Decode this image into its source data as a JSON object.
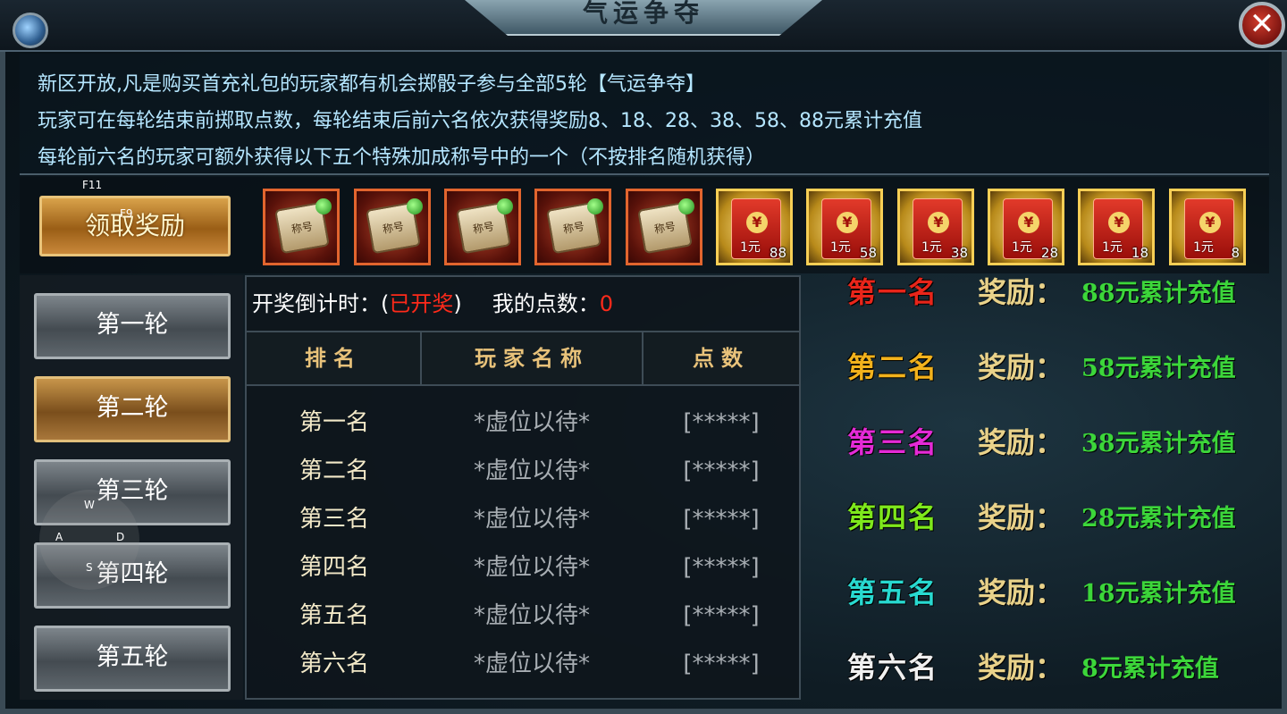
{
  "window": {
    "title": "气运争夺",
    "close_glyph": "✕"
  },
  "intro": {
    "lines": [
      "新区开放,凡是购买首充礼包的玩家都有机会掷骰子参与全部5轮【气运争夺】",
      "玩家可在每轮结束前掷取点数，每轮结束后前六名依次获得奖励8、18、28、38、58、88元累计充值",
      "每轮前六名的玩家可额外获得以下五个特殊加成称号中的一个（不按排名随机获得）"
    ]
  },
  "hotkeys": {
    "f11": "F11",
    "f9": "F9",
    "w": "W",
    "a": "A",
    "s": "S",
    "d": "D"
  },
  "claim_button": {
    "label": "领取奖励"
  },
  "title_items": [
    {
      "label": "称号"
    },
    {
      "label": "称号"
    },
    {
      "label": "称号"
    },
    {
      "label": "称号"
    },
    {
      "label": "称号"
    }
  ],
  "red_envelopes": [
    {
      "label": "1元",
      "qty": "88"
    },
    {
      "label": "1元",
      "qty": "58"
    },
    {
      "label": "1元",
      "qty": "38"
    },
    {
      "label": "1元",
      "qty": "28"
    },
    {
      "label": "1元",
      "qty": "18"
    },
    {
      "label": "1元",
      "qty": "8"
    }
  ],
  "rounds": [
    {
      "label": "第一轮",
      "active": false
    },
    {
      "label": "第二轮",
      "active": true
    },
    {
      "label": "第三轮",
      "active": false
    },
    {
      "label": "第四轮",
      "active": false
    },
    {
      "label": "第五轮",
      "active": false
    }
  ],
  "status": {
    "countdown_label": "开奖倒计时：(",
    "countdown_value": "已开奖",
    "countdown_close": ")",
    "points_label": "我的点数：",
    "points_value": "0"
  },
  "table": {
    "headers": [
      "排名",
      "玩家名称",
      "点数"
    ],
    "rows": [
      {
        "rank": "第一名",
        "name": "*虚位以待*",
        "points": "[*****]"
      },
      {
        "rank": "第二名",
        "name": "*虚位以待*",
        "points": "[*****]"
      },
      {
        "rank": "第三名",
        "name": "*虚位以待*",
        "points": "[*****]"
      },
      {
        "rank": "第四名",
        "name": "*虚位以待*",
        "points": "[*****]"
      },
      {
        "rank": "第五名",
        "name": "*虚位以待*",
        "points": "[*****]"
      },
      {
        "rank": "第六名",
        "name": "*虚位以待*",
        "points": "[*****]"
      }
    ]
  },
  "rewards": [
    {
      "rank": "第一名",
      "label": "奖励：",
      "value": "88元累计充值",
      "color": "#e8251a"
    },
    {
      "rank": "第二名",
      "label": "奖励：",
      "value": "58元累计充值",
      "color": "#f2b21c"
    },
    {
      "rank": "第三名",
      "label": "奖励：",
      "value": "38元累计充值",
      "color": "#e42ad6"
    },
    {
      "rank": "第四名",
      "label": "奖励：",
      "value": "28元累计充值",
      "color": "#7ee81c"
    },
    {
      "rank": "第五名",
      "label": "奖励：",
      "value": "18元累计充值",
      "color": "#28d9d0"
    },
    {
      "rank": "第六名",
      "label": "奖励：",
      "value": "8元累计充值",
      "color": "#f0f0f0"
    }
  ]
}
